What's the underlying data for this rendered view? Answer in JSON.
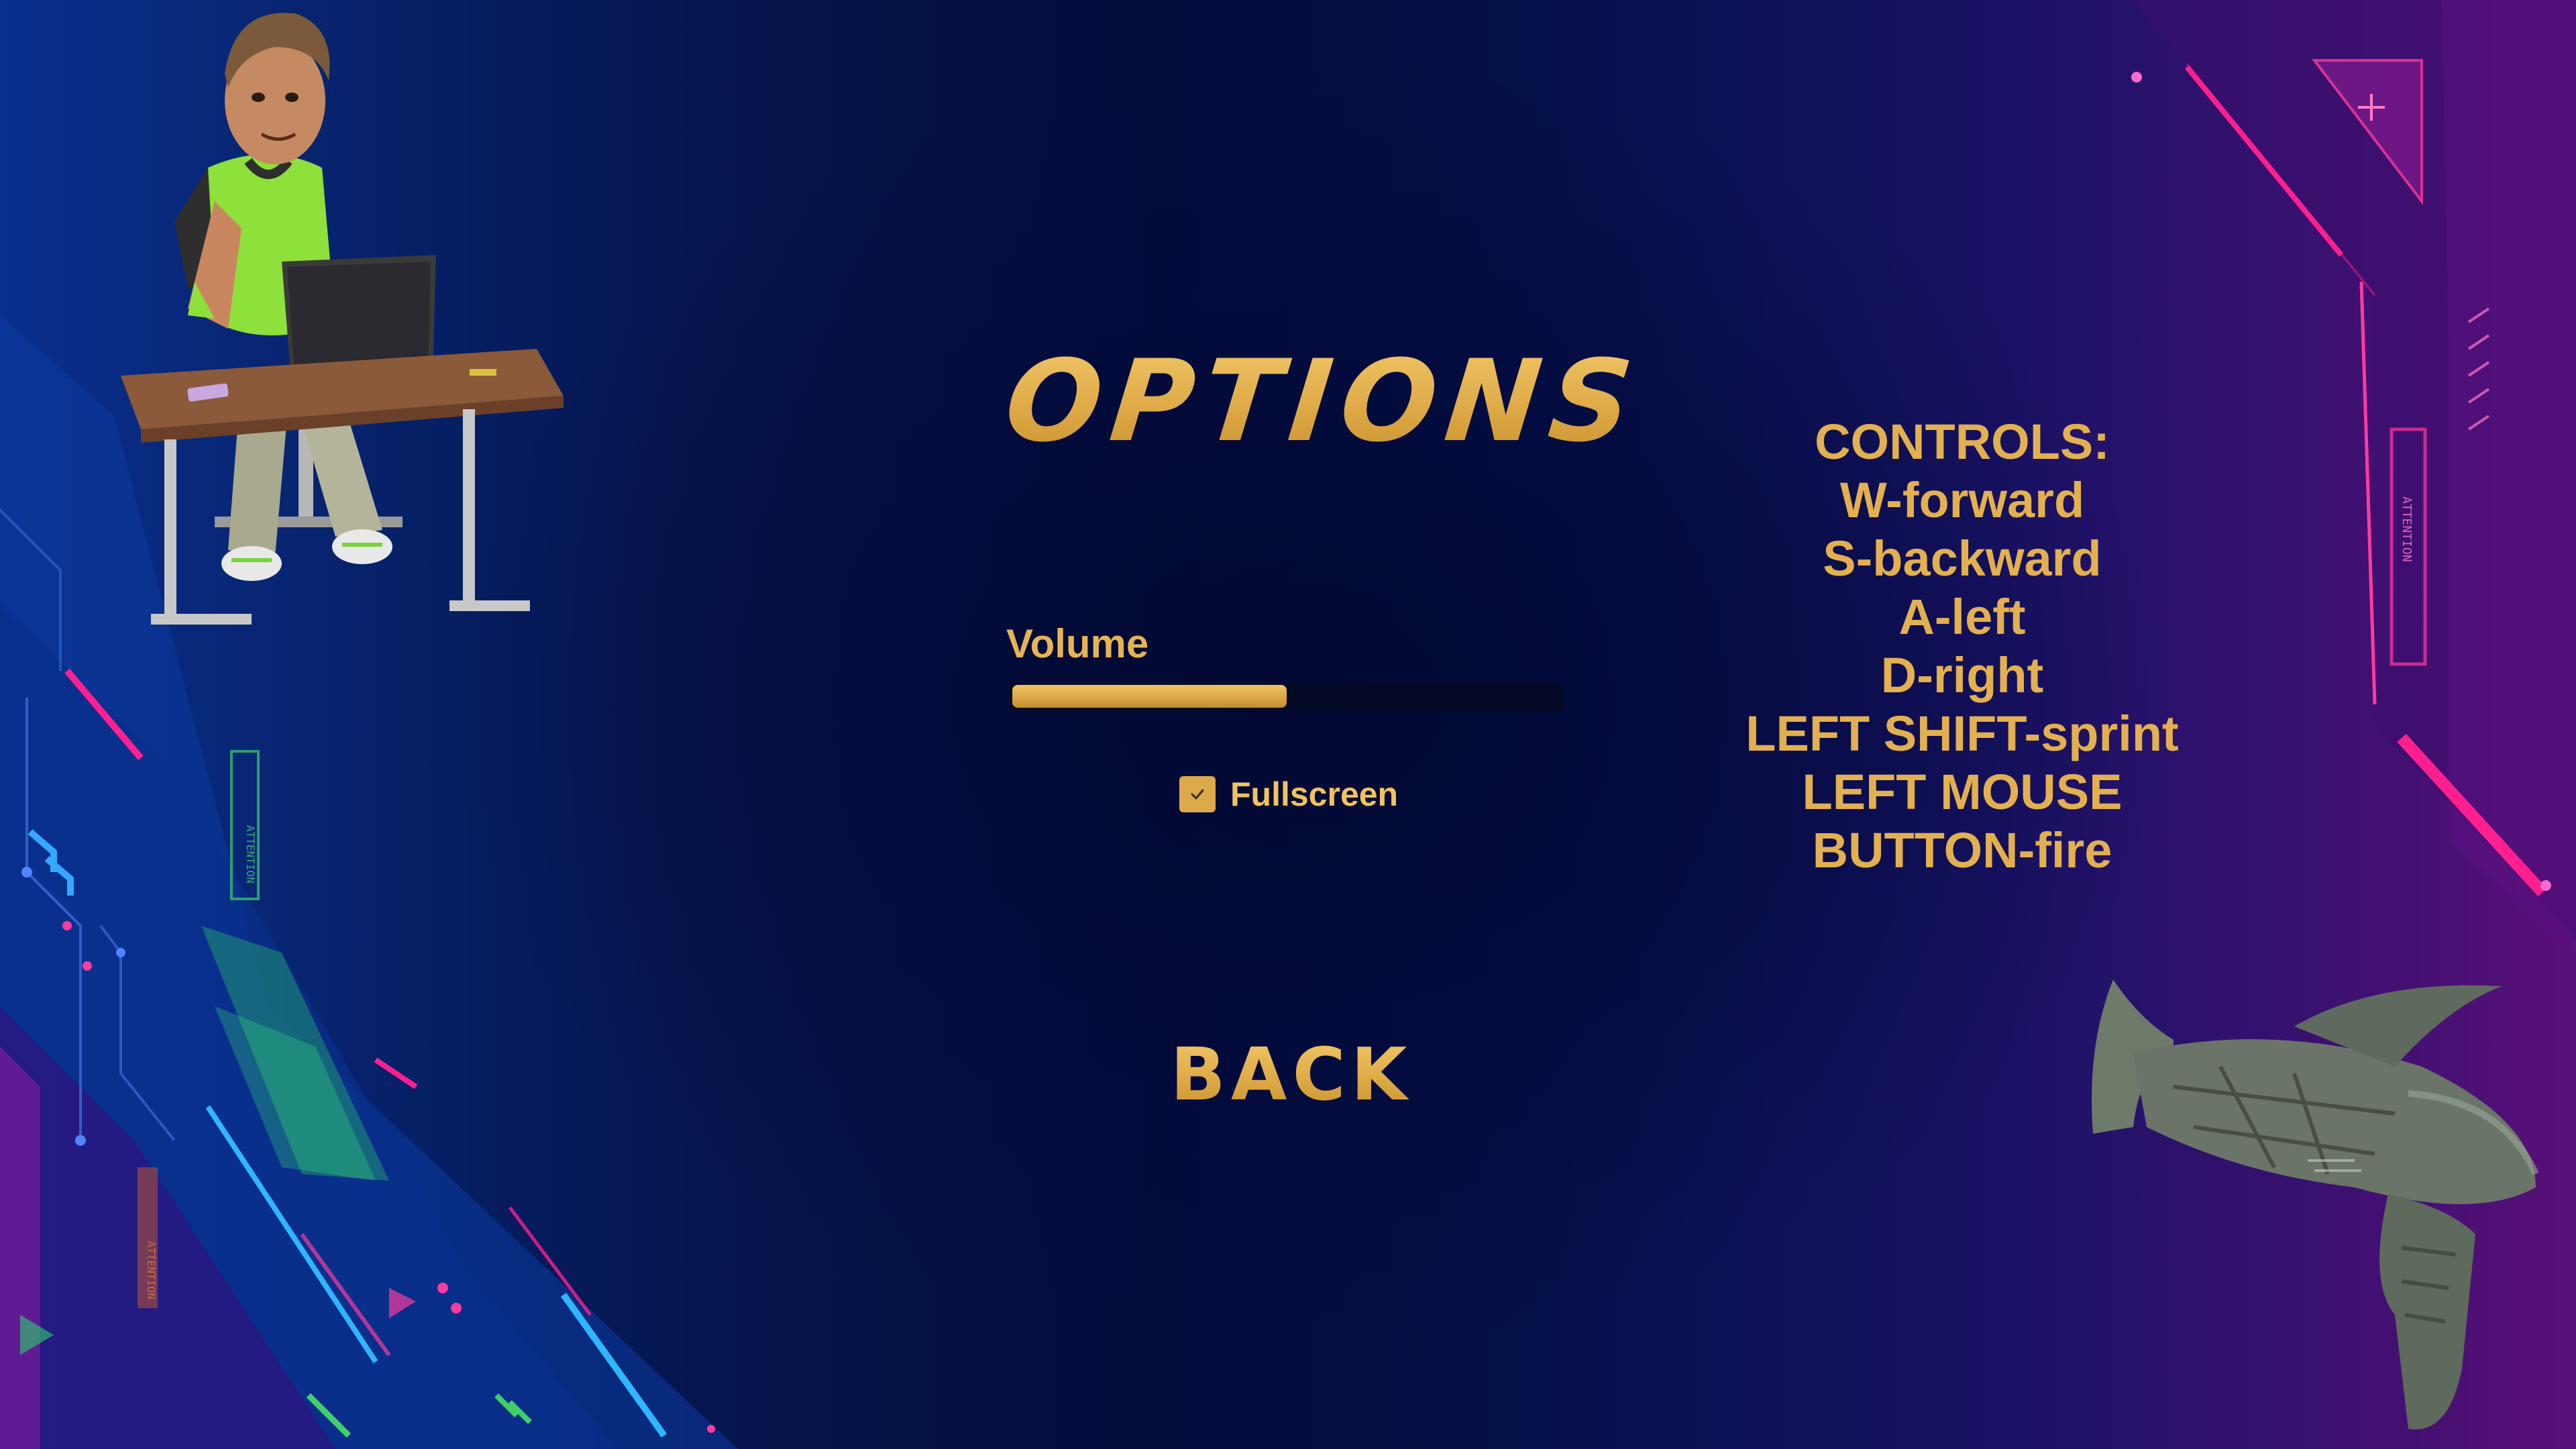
{
  "screen": "options-menu",
  "title": "OPTIONS",
  "settings": {
    "volume_label": "Volume",
    "volume_level": 0.5,
    "fullscreen_label": "Fullscreen",
    "fullscreen_checked": true
  },
  "controls": {
    "text": "CONTROLS:\nW-forward\nS-backward\nA-left\nD-right\nLEFT SHIFT-sprint\nLEFT MOUSE\nBUTTON-fire"
  },
  "back_label": "BACK",
  "decor_text": {
    "attention_left": "ATTENTION",
    "attention_left_low": "ATTENTION",
    "attention_right": "ATTENTION"
  },
  "colors": {
    "accent_gold": "#e2b24e",
    "neon_pink": "#ff1f8e",
    "neon_cyan": "#2fb6ff",
    "neon_green": "#3fd06a",
    "track_dark": "#040a26"
  },
  "icons": {
    "checkbox": "checkmark-icon",
    "character": "character-at-desk",
    "weapon": "raygun"
  }
}
